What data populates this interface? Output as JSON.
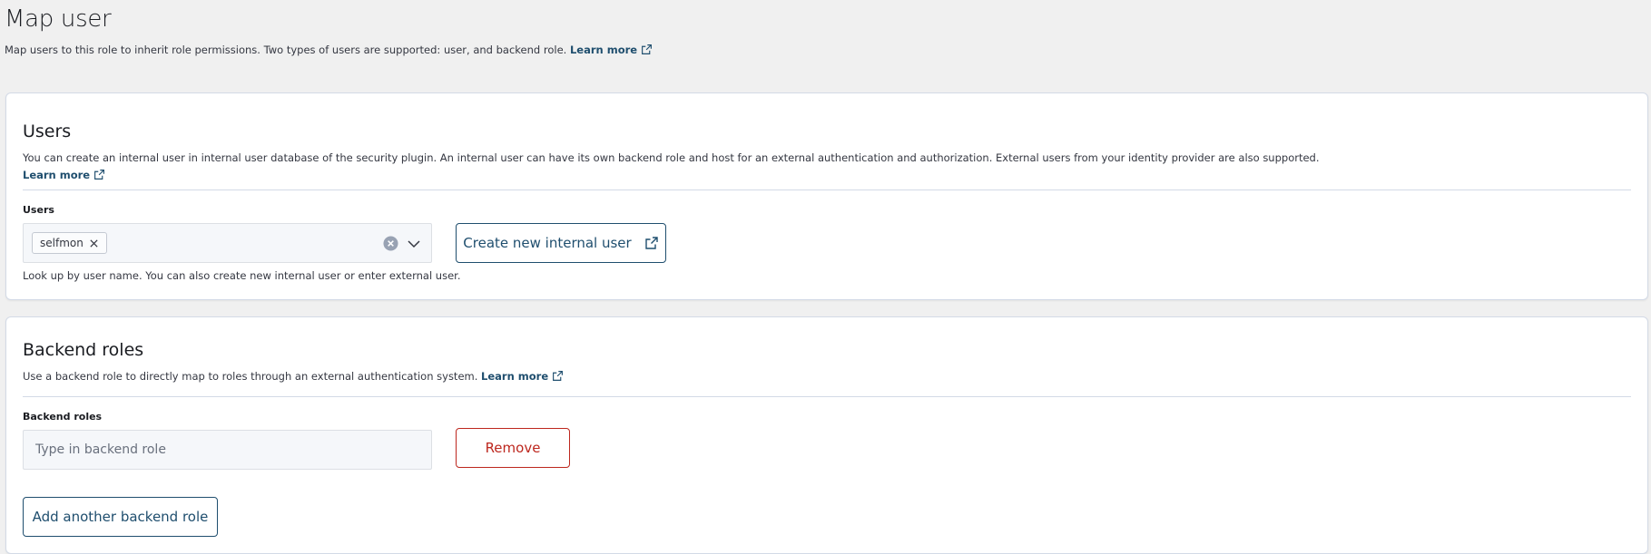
{
  "header": {
    "title": "Map user",
    "description": "Map users to this role to inherit role permissions. Two types of users are supported: user, and backend role.",
    "learn_more": "Learn more"
  },
  "users_panel": {
    "title": "Users",
    "description": "You can create an internal user in internal user database of the security plugin. An internal user can have its own backend role and host for an external authentication and authorization. External users from your identity provider are also supported.",
    "learn_more": "Learn more",
    "field_label": "Users",
    "selected_users": [
      "selfmon"
    ],
    "help_text": "Look up by user name. You can also create new internal user or enter external user.",
    "create_button": "Create new internal user"
  },
  "backend_panel": {
    "title": "Backend roles",
    "description": "Use a backend role to directly map to roles through an external authentication system.",
    "learn_more": "Learn more",
    "field_label": "Backend roles",
    "input_value": "",
    "input_placeholder": "Type in backend role",
    "remove_button": "Remove",
    "add_button": "Add another backend role"
  },
  "colors": {
    "link": "#1f4e6e",
    "danger": "#bd271e",
    "page_bg": "#f0f0f0",
    "panel_border": "#d3dae6"
  },
  "icons": {
    "external_link": "external-link-icon",
    "chip_remove": "close-icon",
    "clear": "clear-circle-icon",
    "dropdown": "chevron-down-icon"
  }
}
